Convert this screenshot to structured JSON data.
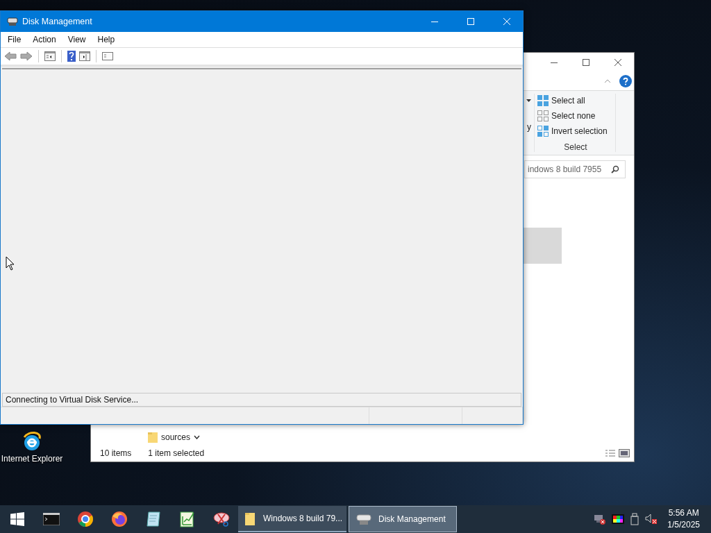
{
  "desktop": {
    "icons": [
      {
        "label": "Internet Explorer"
      }
    ]
  },
  "explorer_window": {
    "ribbon": {
      "cut_text": "y",
      "select_group": {
        "label": "Select",
        "commands": [
          {
            "label": "Select all",
            "kind": "all"
          },
          {
            "label": "Select none",
            "kind": "none"
          },
          {
            "label": "Invert selection",
            "kind": "invert"
          }
        ]
      }
    },
    "search": {
      "value": "indows 8 build 7955"
    },
    "files": [
      {
        "name": "sources"
      }
    ],
    "status_bar": {
      "item_count": "10 items",
      "selection": "1 item selected"
    }
  },
  "disk_management": {
    "title": "Disk Management",
    "menu": [
      "File",
      "Action",
      "View",
      "Help"
    ],
    "status": "Connecting to Virtual Disk Service..."
  },
  "taskbar": {
    "pinned": [
      {
        "kind": "terminal"
      },
      {
        "kind": "chrome"
      },
      {
        "kind": "firefox"
      },
      {
        "kind": "notepad"
      },
      {
        "kind": "chart"
      },
      {
        "kind": "snip"
      }
    ],
    "tasks": [
      {
        "label": "Windows 8 build 79...",
        "kind": "folder",
        "selected": false
      },
      {
        "label": "Disk Management",
        "kind": "disk",
        "selected": true
      }
    ],
    "tray": {
      "time": "5:56 AM",
      "date": "1/5/2025"
    }
  }
}
